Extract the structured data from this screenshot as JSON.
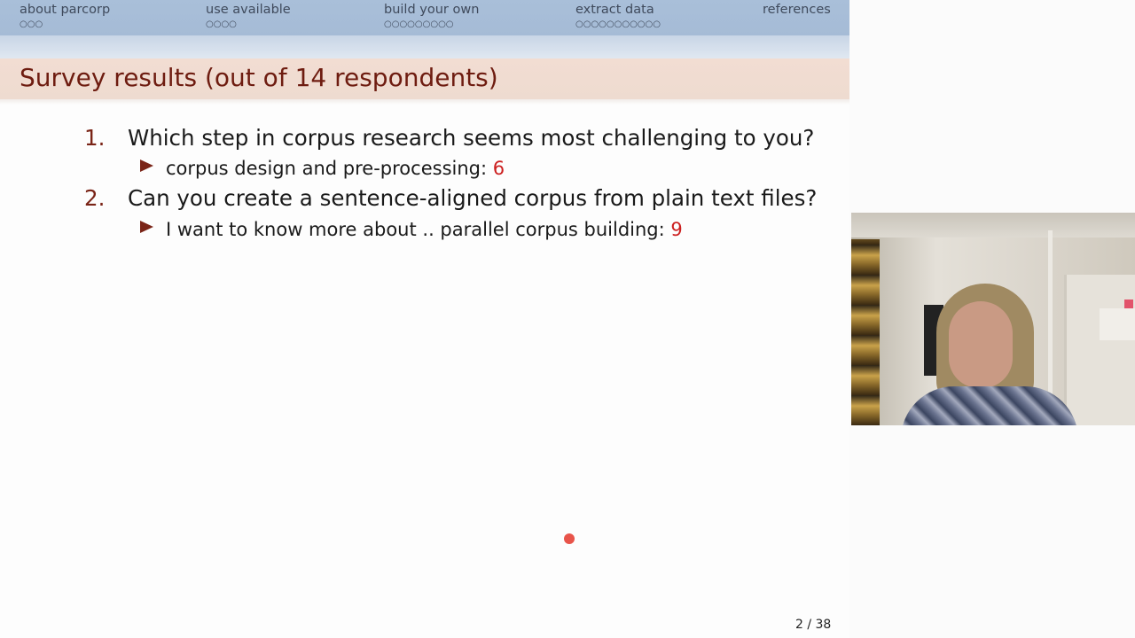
{
  "nav": {
    "sections": [
      {
        "label": "about parcorp",
        "dots": "○○○"
      },
      {
        "label": "use available",
        "dots": "○○○○"
      },
      {
        "label": "build your own",
        "dots": "○○○○○○○○○"
      },
      {
        "label": "extract data",
        "dots": "○○○○○○○○○○○"
      },
      {
        "label": "references",
        "dots": ""
      }
    ]
  },
  "slide": {
    "title": "Survey results (out of 14 respondents)",
    "items": [
      {
        "num": "1.",
        "question": "Which step in corpus research seems most challenging to you?",
        "answer_text": "corpus design and pre-processing: ",
        "answer_count": "6"
      },
      {
        "num": "2.",
        "question": "Can you create a sentence-aligned corpus from plain text files?",
        "answer_text": "I want to know more about .. parallel corpus building: ",
        "answer_count": "9"
      }
    ],
    "page_number": "2 / 38"
  },
  "colors": {
    "nav_bg": "#a9bfd9",
    "title_bg": "#f2ddd2",
    "title_text": "#6e1c10",
    "count_text": "#cc1f1f",
    "pointer": "#e8544a"
  },
  "icons": {
    "bullet": "triangle-right-icon",
    "pointer": "laser-pointer-dot"
  }
}
